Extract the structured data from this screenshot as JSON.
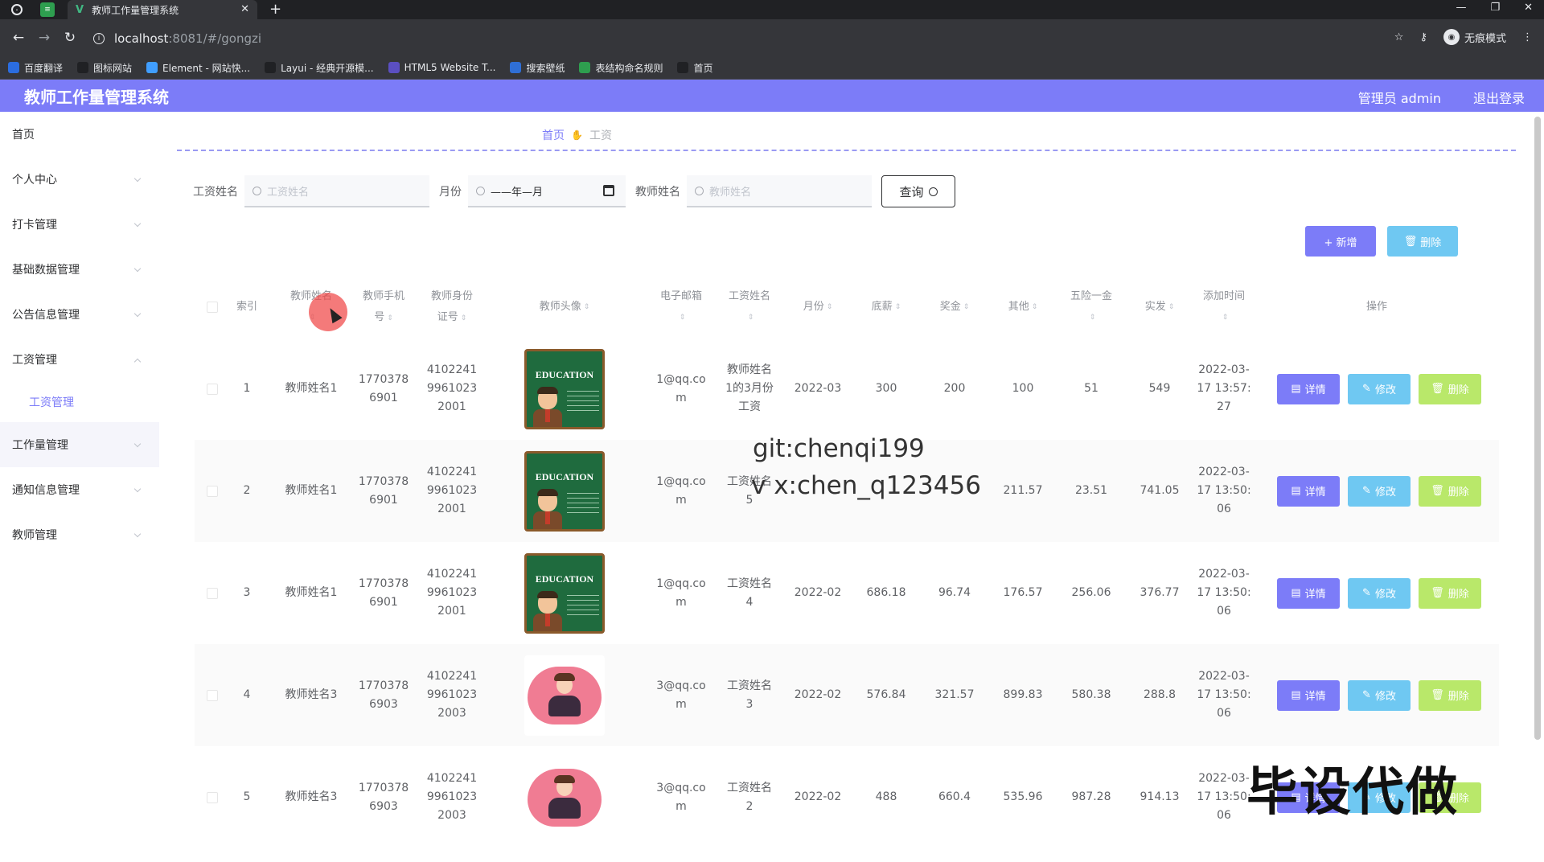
{
  "browser": {
    "tab_title": "教师工作量管理系统",
    "url_host": "localhost",
    "url_path": ":8081/#/gongzi",
    "incognito_label": "无痕模式",
    "bookmarks": [
      {
        "label": "百度翻译",
        "color": "#2b6de0"
      },
      {
        "label": "图标网站",
        "color": "#202124"
      },
      {
        "label": "Element - 网站快...",
        "color": "#409eff"
      },
      {
        "label": "Layui - 经典开源模...",
        "color": "#202124"
      },
      {
        "label": "HTML5 Website T...",
        "color": "#5b4fc2"
      },
      {
        "label": "搜索壁纸",
        "color": "#2f6fd6"
      },
      {
        "label": "表结构命名规则",
        "color": "#2e9e4f"
      },
      {
        "label": "首页",
        "color": "#202124"
      }
    ]
  },
  "header": {
    "title": "教师工作量管理系统",
    "user": "管理员 admin",
    "logout": "退出登录"
  },
  "sidebar": {
    "items": [
      {
        "label": "首页"
      },
      {
        "label": "个人中心"
      },
      {
        "label": "打卡管理"
      },
      {
        "label": "基础数据管理"
      },
      {
        "label": "公告信息管理"
      },
      {
        "label": "工资管理"
      },
      {
        "label": "工资管理"
      },
      {
        "label": "工作量管理"
      },
      {
        "label": "通知信息管理"
      },
      {
        "label": "教师管理"
      }
    ]
  },
  "breadcrumb": {
    "home": "首页",
    "current": "工资"
  },
  "search": {
    "name_label": "工资姓名",
    "name_placeholder": "工资姓名",
    "month_label": "月份",
    "month_value": "——年—月",
    "teacher_label": "教师姓名",
    "teacher_placeholder": "教师姓名",
    "query_btn": "查询"
  },
  "actions": {
    "add": "+ 新增",
    "delete": "删除"
  },
  "table": {
    "headers": {
      "index": "索引",
      "teacher_name": "教师姓名",
      "phone_1": "教师手机",
      "phone_2": "号",
      "idcard_1": "教师身份",
      "idcard_2": "证号",
      "avatar": "教师头像",
      "email": "电子邮箱",
      "salary_name": "工资姓名",
      "month": "月份",
      "base": "底薪",
      "bonus": "奖金",
      "other": "其他",
      "insurance": "五险一金",
      "actual": "实发",
      "added": "添加时间",
      "ops": "操作"
    },
    "op_labels": {
      "view": "详情",
      "edit": "修改",
      "del": "删除"
    },
    "rows": [
      {
        "index": "1",
        "teacher": "教师姓名1",
        "phone_a": "1770378",
        "phone_b": "6901",
        "id_a": "4102241",
        "id_b": "9961023",
        "id_c": "2001",
        "avatar": "education",
        "email_a": "1@qq.co",
        "email_b": "m",
        "salary_a": "教师姓名",
        "salary_b": "1的3月份",
        "salary_c": "工资",
        "month": "2022-03",
        "base": "300",
        "bonus": "200",
        "other": "100",
        "insurance": "51",
        "actual": "549",
        "time_a": "2022-03-",
        "time_b": "17 13:57:",
        "time_c": "27"
      },
      {
        "index": "2",
        "teacher": "教师姓名1",
        "phone_a": "1770378",
        "phone_b": "6901",
        "id_a": "4102241",
        "id_b": "9961023",
        "id_c": "2001",
        "avatar": "education",
        "email_a": "1@qq.co",
        "email_b": "m",
        "salary_a": "工资姓名",
        "salary_b": "5",
        "salary_c": "",
        "month": "",
        "base": "",
        "bonus": "",
        "other": "211.57",
        "insurance": "23.51",
        "actual": "741.05",
        "time_a": "2022-03-",
        "time_b": "17 13:50:",
        "time_c": "06"
      },
      {
        "index": "3",
        "teacher": "教师姓名1",
        "phone_a": "1770378",
        "phone_b": "6901",
        "id_a": "4102241",
        "id_b": "9961023",
        "id_c": "2001",
        "avatar": "education",
        "email_a": "1@qq.co",
        "email_b": "m",
        "salary_a": "工资姓名",
        "salary_b": "4",
        "salary_c": "",
        "month": "2022-02",
        "base": "686.18",
        "bonus": "96.74",
        "other": "176.57",
        "insurance": "256.06",
        "actual": "376.77",
        "time_a": "2022-03-",
        "time_b": "17 13:50:",
        "time_c": "06"
      },
      {
        "index": "4",
        "teacher": "教师姓名3",
        "phone_a": "1770378",
        "phone_b": "6903",
        "id_a": "4102241",
        "id_b": "9961023",
        "id_c": "2003",
        "avatar": "girl",
        "email_a": "3@qq.co",
        "email_b": "m",
        "salary_a": "工资姓名",
        "salary_b": "3",
        "salary_c": "",
        "month": "2022-02",
        "base": "576.84",
        "bonus": "321.57",
        "other": "899.83",
        "insurance": "580.38",
        "actual": "288.8",
        "time_a": "2022-03-",
        "time_b": "17 13:50:",
        "time_c": "06"
      },
      {
        "index": "5",
        "teacher": "教师姓名3",
        "phone_a": "1770378",
        "phone_b": "6903",
        "id_a": "4102241",
        "id_b": "9961023",
        "id_c": "2003",
        "avatar": "girl",
        "email_a": "3@qq.co",
        "email_b": "m",
        "salary_a": "工资姓名",
        "salary_b": "2",
        "salary_c": "",
        "month": "2022-02",
        "base": "488",
        "bonus": "660.4",
        "other": "535.96",
        "insurance": "987.28",
        "actual": "914.13",
        "time_a": "2022-03-",
        "time_b": "17 13:50:",
        "time_c": "06"
      }
    ]
  },
  "watermarks": {
    "git": "git:chenqi199",
    "vx": "v x:chen_q123456",
    "big": "毕设代做"
  },
  "colors": {
    "accent": "#7c7cf8",
    "info": "#6fc8f2",
    "success": "#b9e86a"
  }
}
